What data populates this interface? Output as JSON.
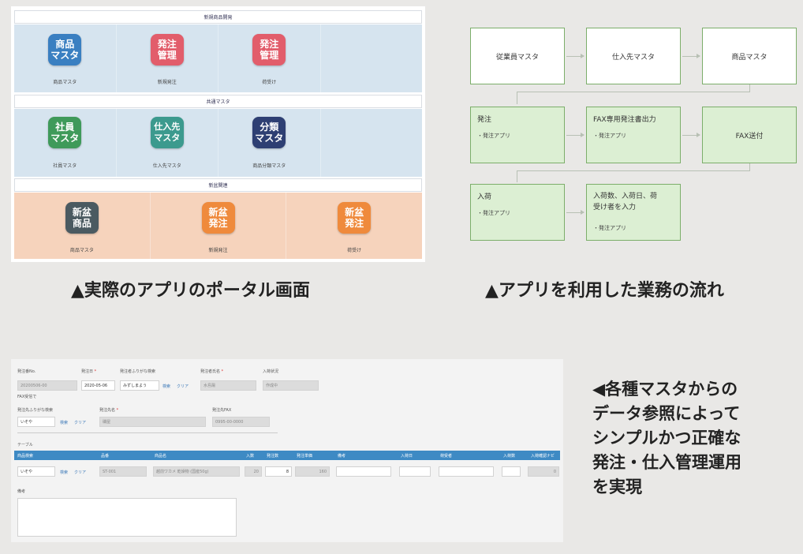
{
  "portal": {
    "sections": [
      {
        "title": "新規商品開発"
      },
      {
        "title": "共通マスタ"
      },
      {
        "title": "新盆関連"
      }
    ],
    "row1": [
      {
        "icon_text": [
          "商品",
          "マスタ"
        ],
        "color": "#3a7fc1",
        "label": "商品マスタ"
      },
      {
        "icon_text": [
          "発注",
          "管理"
        ],
        "color": "#e25d6b",
        "label": "新規発注"
      },
      {
        "icon_text": [
          "発注",
          "管理"
        ],
        "color": "#e25d6b",
        "label": "荷受け"
      }
    ],
    "row2": [
      {
        "icon_text": [
          "社員",
          "マスタ"
        ],
        "color": "#3f9a5a",
        "label": "社員マスタ"
      },
      {
        "icon_text": [
          "仕入先",
          "マスタ"
        ],
        "color": "#3c9a8e",
        "label": "仕入先マスタ"
      },
      {
        "icon_text": [
          "分類",
          "マスタ"
        ],
        "color": "#2e3f73",
        "label": "商品分類マスタ"
      }
    ],
    "row3": [
      {
        "icon_text": [
          "新盆",
          "商品"
        ],
        "color": "#4b5a61",
        "label": "商品マスタ"
      },
      {
        "icon_text": [
          "新盆",
          "発注"
        ],
        "color": "#ef8a3c",
        "label": "新規発注"
      },
      {
        "icon_text": [
          "新盆",
          "発注"
        ],
        "color": "#ef8a3c",
        "label": "荷受け"
      }
    ]
  },
  "flow": {
    "row1": [
      "従業員マスタ",
      "仕入先マスタ",
      "商品マスタ"
    ],
    "row2": [
      {
        "title": "発注",
        "sub": "・発注アプリ"
      },
      {
        "title": "FAX専用発注書出力",
        "sub": "・発注アプリ"
      },
      {
        "title": "FAX送付",
        "sub": ""
      }
    ],
    "row3": [
      {
        "title": "入荷",
        "sub": "・発注アプリ"
      },
      {
        "title_lines": [
          "入荷数、入荷日、荷",
          "受け者を入力"
        ],
        "sub": "・発注アプリ"
      }
    ]
  },
  "captions": {
    "portal": "▲実際のアプリのポータル画面",
    "flow": "▲アプリを利用した業務の流れ"
  },
  "form": {
    "labels": {
      "order_no": "発注番No.",
      "order_date": "発注日",
      "kana_search": "発注者ふりがな検索",
      "orderer_name": "発注者氏名",
      "arrival_status": "入荷状況",
      "fax_sent": "FAX受信で",
      "supplier_kana": "発注先ふりがな検索",
      "supplier_name": "発注先名",
      "supplier_fax": "発注先FAX",
      "table_title": "テーブル",
      "notes": "備考"
    },
    "values": {
      "order_no": "20200506-00",
      "order_date": "2020-05-06",
      "kana_search": "みずしまよう",
      "orderer_name": "水島陽",
      "arrival_status": "作成中",
      "supplier_kana": "いそや",
      "supplier_name": "磯屋",
      "supplier_fax": "0995-00-0000",
      "row_kana": "いそや",
      "row_code": "ST-001",
      "row_name": "越前ワカメ 乾燥物 (国産50g)",
      "row_unit": "20",
      "row_qty": "8",
      "row_amount": "160",
      "row_price": "0"
    },
    "search_link": "検索",
    "clear_link": "クリア",
    "required_mark": "*",
    "table_headers": [
      "商品検索",
      "品番",
      "商品名",
      "入数",
      "発注数",
      "発注単価",
      "備考",
      "入荷日",
      "荷受者",
      "入荷数",
      "入荷確認ナビ"
    ]
  },
  "right_text": [
    "◀各種マスタからの",
    "データ参照によって",
    "シンプルかつ正確な",
    "発注・仕入管理運用",
    "を実現"
  ]
}
